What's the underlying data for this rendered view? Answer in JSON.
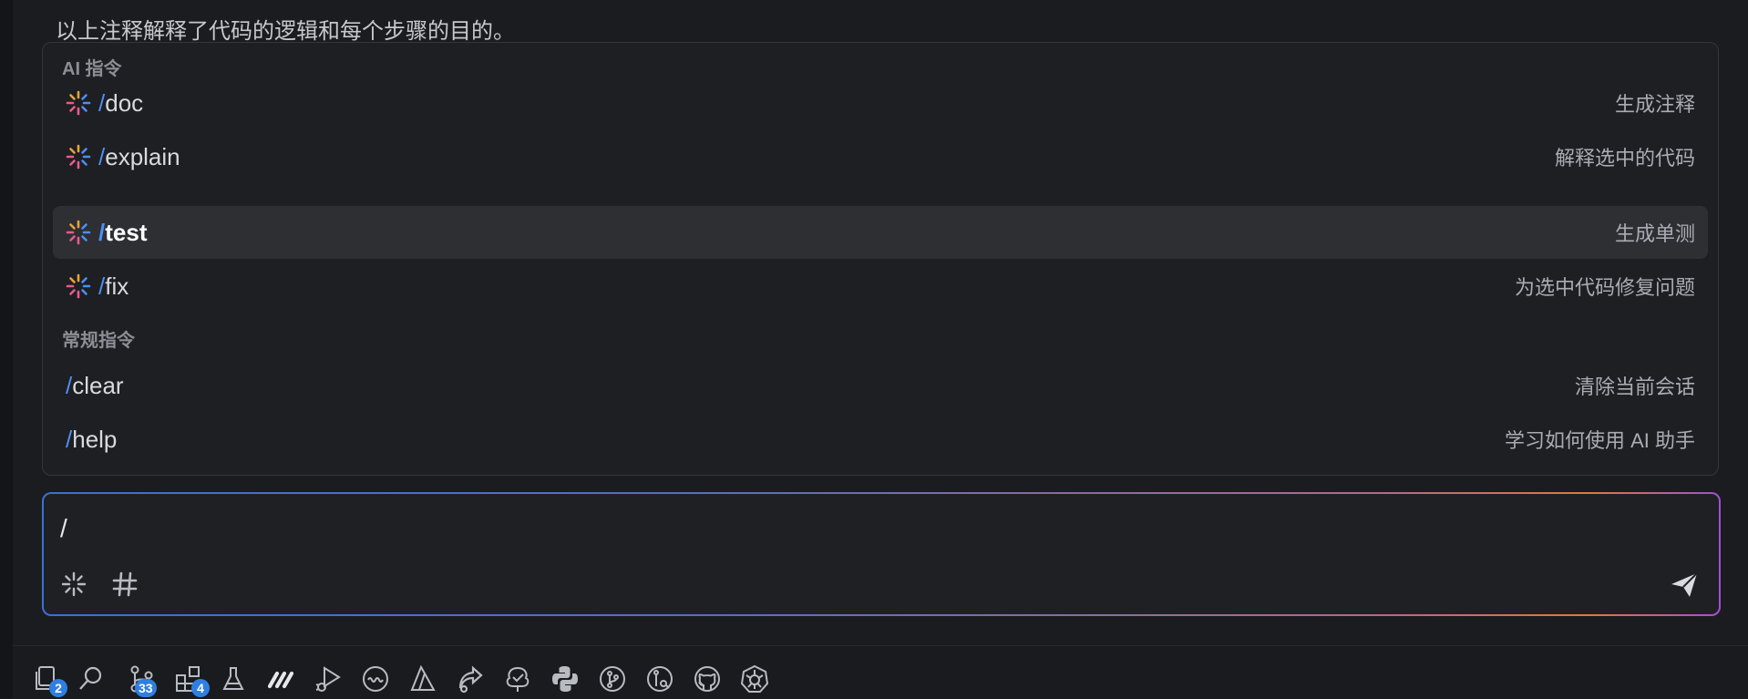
{
  "chat": {
    "previous_text": "以上注释解释了代码的逻辑和每个步骤的目的。"
  },
  "popup": {
    "ai_group_label": "AI 指令",
    "ai_commands": [
      {
        "slash": "/",
        "name": "doc",
        "desc": "生成注释",
        "icon": "sparkle-icon"
      },
      {
        "slash": "/",
        "name": "explain",
        "desc": "解释选中的代码",
        "icon": "sparkle-icon"
      },
      {
        "slash": "/",
        "name": "test",
        "desc": "生成单测",
        "icon": "sparkle-icon",
        "selected": true
      },
      {
        "slash": "/",
        "name": "fix",
        "desc": "为选中代码修复问题",
        "icon": "sparkle-icon"
      }
    ],
    "general_group_label": "常规指令",
    "general_commands": [
      {
        "slash": "/",
        "name": "clear",
        "desc": "清除当前会话"
      },
      {
        "slash": "/",
        "name": "help",
        "desc": "学习如何使用 AI 助手"
      }
    ]
  },
  "input": {
    "value": "/",
    "tools": [
      "sparkle-icon",
      "hash-icon"
    ],
    "send_icon": "send-icon"
  },
  "activity_bar": {
    "items": [
      {
        "icon": "explorer-icon",
        "badge": "2"
      },
      {
        "icon": "search-icon"
      },
      {
        "icon": "source-control-icon",
        "badge": "33"
      },
      {
        "icon": "extensions-icon",
        "badge": "4"
      },
      {
        "icon": "testing-icon"
      },
      {
        "icon": "ai-assistant-icon"
      },
      {
        "icon": "run-debug-icon"
      },
      {
        "icon": "wave-icon"
      },
      {
        "icon": "azure-icon"
      },
      {
        "icon": "share-icon"
      },
      {
        "icon": "tree-check-icon"
      },
      {
        "icon": "python-icon"
      },
      {
        "icon": "git-graph-icon"
      },
      {
        "icon": "git-lens-icon"
      },
      {
        "icon": "github-icon"
      },
      {
        "icon": "kubernetes-icon"
      }
    ]
  },
  "colors": {
    "accent": "#4d8ef7",
    "badge": "#2f7fe0",
    "selected_row": "#2d2f33"
  }
}
